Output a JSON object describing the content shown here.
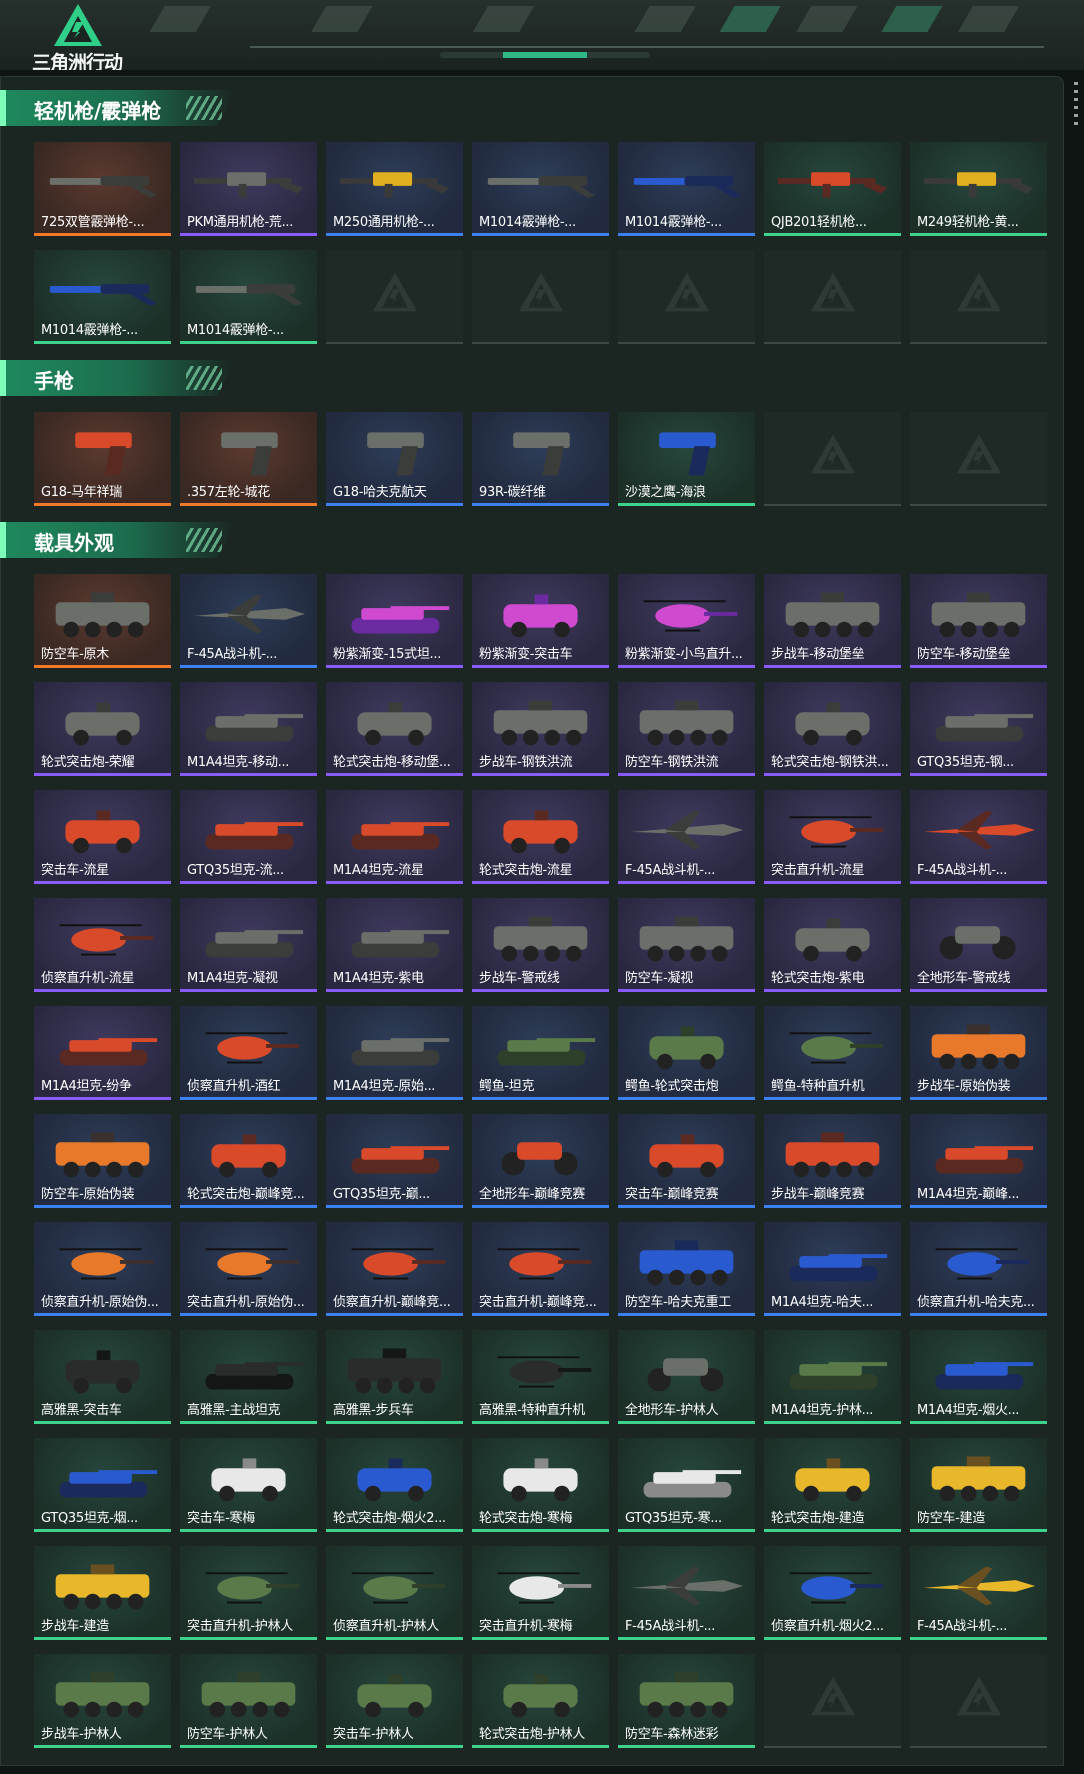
{
  "header": {
    "logo_text": "三角洲行动"
  },
  "colors": {
    "orange": "#f07a2a",
    "purple": "#8a5cff",
    "blue": "#3b82f0",
    "green": "#3ed38d",
    "accent": "#1e8a5e"
  },
  "sections": [
    {
      "title": "轻机枪/霰弹枪",
      "items": [
        {
          "label": "725双管霰弹枪-...",
          "rarity": "orange",
          "icon": "shotgun"
        },
        {
          "label": "PKM通用机枪-荒...",
          "rarity": "purple",
          "icon": "rifle"
        },
        {
          "label": "M250通用机枪-...",
          "rarity": "blue",
          "icon": "rifle-gold"
        },
        {
          "label": "M1014霰弹枪-...",
          "rarity": "blue",
          "icon": "shotgun"
        },
        {
          "label": "M1014霰弹枪-...",
          "rarity": "blue",
          "icon": "shotgun-blue"
        },
        {
          "label": "QJB201轻机枪...",
          "rarity": "green",
          "icon": "rifle-red"
        },
        {
          "label": "M249轻机枪-黄...",
          "rarity": "green",
          "icon": "rifle-gold"
        },
        {
          "label": "M1014霰弹枪-...",
          "rarity": "green",
          "icon": "shotgun-blue"
        },
        {
          "label": "M1014霰弹枪-...",
          "rarity": "green",
          "icon": "shotgun"
        },
        {
          "label": "",
          "rarity": "empty"
        },
        {
          "label": "",
          "rarity": "empty"
        },
        {
          "label": "",
          "rarity": "empty"
        },
        {
          "label": "",
          "rarity": "empty"
        },
        {
          "label": "",
          "rarity": "empty"
        }
      ]
    },
    {
      "title": "手枪",
      "items": [
        {
          "label": "G18-马年祥瑞",
          "rarity": "orange",
          "icon": "pistol-red"
        },
        {
          "label": ".357左轮-城花",
          "rarity": "orange",
          "icon": "revolver"
        },
        {
          "label": "G18-哈夫克航天",
          "rarity": "blue",
          "icon": "pistol"
        },
        {
          "label": "93R-碳纤维",
          "rarity": "blue",
          "icon": "pistol"
        },
        {
          "label": "沙漠之鹰-海浪",
          "rarity": "green",
          "icon": "pistol-blue"
        },
        {
          "label": "",
          "rarity": "empty"
        },
        {
          "label": "",
          "rarity": "empty"
        }
      ]
    },
    {
      "title": "载具外观",
      "items": [
        {
          "label": "防空车-原木",
          "rarity": "orange",
          "icon": "apc"
        },
        {
          "label": "F-45A战斗机-...",
          "rarity": "blue",
          "icon": "jet"
        },
        {
          "label": "粉紫渐变-15式坦...",
          "rarity": "purple",
          "icon": "tank-pink"
        },
        {
          "label": "粉紫渐变-突击车",
          "rarity": "purple",
          "icon": "car-pink"
        },
        {
          "label": "粉紫渐变-小鸟直升...",
          "rarity": "purple",
          "icon": "heli-pink"
        },
        {
          "label": "步战车-移动堡垒",
          "rarity": "purple",
          "icon": "apc"
        },
        {
          "label": "防空车-移动堡垒",
          "rarity": "purple",
          "icon": "apc"
        },
        {
          "label": "轮式突击炮-荣耀",
          "rarity": "purple",
          "icon": "car"
        },
        {
          "label": "M1A4坦克-移动...",
          "rarity": "purple",
          "icon": "tank"
        },
        {
          "label": "轮式突击炮-移动堡...",
          "rarity": "purple",
          "icon": "car"
        },
        {
          "label": "步战车-钢铁洪流",
          "rarity": "purple",
          "icon": "apc"
        },
        {
          "label": "防空车-钢铁洪流",
          "rarity": "purple",
          "icon": "apc"
        },
        {
          "label": "轮式突击炮-钢铁洪...",
          "rarity": "purple",
          "icon": "car"
        },
        {
          "label": "GTQ35坦克-钢...",
          "rarity": "purple",
          "icon": "tank"
        },
        {
          "label": "突击车-流星",
          "rarity": "purple",
          "icon": "car-red"
        },
        {
          "label": "GTQ35坦克-流...",
          "rarity": "purple",
          "icon": "tank-red"
        },
        {
          "label": "M1A4坦克-流星",
          "rarity": "purple",
          "icon": "tank-red"
        },
        {
          "label": "轮式突击炮-流星",
          "rarity": "purple",
          "icon": "car-red"
        },
        {
          "label": "F-45A战斗机-...",
          "rarity": "purple",
          "icon": "jet"
        },
        {
          "label": "突击直升机-流星",
          "rarity": "purple",
          "icon": "heli-red"
        },
        {
          "label": "F-45A战斗机-...",
          "rarity": "purple",
          "icon": "jet-red"
        },
        {
          "label": "侦察直升机-流星",
          "rarity": "purple",
          "icon": "heli-red"
        },
        {
          "label": "M1A4坦克-凝视",
          "rarity": "purple",
          "icon": "tank"
        },
        {
          "label": "M1A4坦克-紫电",
          "rarity": "purple",
          "icon": "tank"
        },
        {
          "label": "步战车-警戒线",
          "rarity": "purple",
          "icon": "apc"
        },
        {
          "label": "防空车-凝视",
          "rarity": "purple",
          "icon": "apc"
        },
        {
          "label": "轮式突击炮-紫电",
          "rarity": "purple",
          "icon": "car"
        },
        {
          "label": "全地形车-警戒线",
          "rarity": "purple",
          "icon": "atv"
        },
        {
          "label": "M1A4坦克-纷争",
          "rarity": "purple",
          "icon": "tank-red"
        },
        {
          "label": "侦察直升机-酒红",
          "rarity": "blue",
          "icon": "heli-red"
        },
        {
          "label": "M1A4坦克-原始...",
          "rarity": "blue",
          "icon": "tank"
        },
        {
          "label": "鳄鱼-坦克",
          "rarity": "blue",
          "icon": "tank-green"
        },
        {
          "label": "鳄鱼-轮式突击炮",
          "rarity": "blue",
          "icon": "car-green"
        },
        {
          "label": "鳄鱼-特种直升机",
          "rarity": "blue",
          "icon": "heli-green"
        },
        {
          "label": "步战车-原始伪装",
          "rarity": "blue",
          "icon": "apc-orange"
        },
        {
          "label": "防空车-原始伪装",
          "rarity": "blue",
          "icon": "apc-orange"
        },
        {
          "label": "轮式突击炮-巅峰竞...",
          "rarity": "blue",
          "icon": "car-red"
        },
        {
          "label": "GTQ35坦克-巅...",
          "rarity": "blue",
          "icon": "tank-red"
        },
        {
          "label": "全地形车-巅峰竞赛",
          "rarity": "blue",
          "icon": "atv-red"
        },
        {
          "label": "突击车-巅峰竞赛",
          "rarity": "blue",
          "icon": "car-red"
        },
        {
          "label": "步战车-巅峰竞赛",
          "rarity": "blue",
          "icon": "apc-red"
        },
        {
          "label": "M1A4坦克-巅峰...",
          "rarity": "blue",
          "icon": "tank-red"
        },
        {
          "label": "侦察直升机-原始伪...",
          "rarity": "blue",
          "icon": "heli-orange"
        },
        {
          "label": "突击直升机-原始伪...",
          "rarity": "blue",
          "icon": "heli-orange"
        },
        {
          "label": "侦察直升机-巅峰竞...",
          "rarity": "blue",
          "icon": "heli-red"
        },
        {
          "label": "突击直升机-巅峰竞...",
          "rarity": "blue",
          "icon": "heli-red"
        },
        {
          "label": "防空车-哈夫克重工",
          "rarity": "blue",
          "icon": "apc-blue"
        },
        {
          "label": "M1A4坦克-哈夫...",
          "rarity": "blue",
          "icon": "tank-blue"
        },
        {
          "label": "侦察直升机-哈夫克...",
          "rarity": "blue",
          "icon": "heli-blue"
        },
        {
          "label": "高雅黑-突击车",
          "rarity": "green",
          "icon": "car-black"
        },
        {
          "label": "高雅黑-主战坦克",
          "rarity": "green",
          "icon": "tank-black"
        },
        {
          "label": "高雅黑-步兵车",
          "rarity": "green",
          "icon": "apc-black"
        },
        {
          "label": "高雅黑-特种直升机",
          "rarity": "green",
          "icon": "heli-black"
        },
        {
          "label": "全地形车-护林人",
          "rarity": "green",
          "icon": "atv"
        },
        {
          "label": "M1A4坦克-护林...",
          "rarity": "green",
          "icon": "tank-green"
        },
        {
          "label": "M1A4坦克-烟火...",
          "rarity": "green",
          "icon": "tank-blue"
        },
        {
          "label": "GTQ35坦克-烟...",
          "rarity": "green",
          "icon": "tank-blue"
        },
        {
          "label": "突击车-寒梅",
          "rarity": "green",
          "icon": "car-white"
        },
        {
          "label": "轮式突击炮-烟火2...",
          "rarity": "green",
          "icon": "car-blue"
        },
        {
          "label": "轮式突击炮-寒梅",
          "rarity": "green",
          "icon": "car-white"
        },
        {
          "label": "GTQ35坦克-寒...",
          "rarity": "green",
          "icon": "tank-white"
        },
        {
          "label": "轮式突击炮-建造",
          "rarity": "green",
          "icon": "car-yellow"
        },
        {
          "label": "防空车-建造",
          "rarity": "green",
          "icon": "apc-yellow"
        },
        {
          "label": "步战车-建造",
          "rarity": "green",
          "icon": "apc-yellow"
        },
        {
          "label": "突击直升机-护林人",
          "rarity": "green",
          "icon": "heli-green"
        },
        {
          "label": "侦察直升机-护林人",
          "rarity": "green",
          "icon": "heli-green"
        },
        {
          "label": "突击直升机-寒梅",
          "rarity": "green",
          "icon": "heli-white"
        },
        {
          "label": "F-45A战斗机-...",
          "rarity": "green",
          "icon": "jet"
        },
        {
          "label": "侦察直升机-烟火2...",
          "rarity": "green",
          "icon": "heli-blue"
        },
        {
          "label": "F-45A战斗机-...",
          "rarity": "green",
          "icon": "jet-yellow"
        },
        {
          "label": "步战车-护林人",
          "rarity": "green",
          "icon": "apc-green"
        },
        {
          "label": "防空车-护林人",
          "rarity": "green",
          "icon": "apc-green"
        },
        {
          "label": "突击车-护林人",
          "rarity": "green",
          "icon": "car-green"
        },
        {
          "label": "轮式突击炮-护林人",
          "rarity": "green",
          "icon": "car-green"
        },
        {
          "label": "防空车-森林迷彩",
          "rarity": "green",
          "icon": "apc-green"
        },
        {
          "label": "",
          "rarity": "empty"
        },
        {
          "label": "",
          "rarity": "empty"
        }
      ]
    }
  ]
}
